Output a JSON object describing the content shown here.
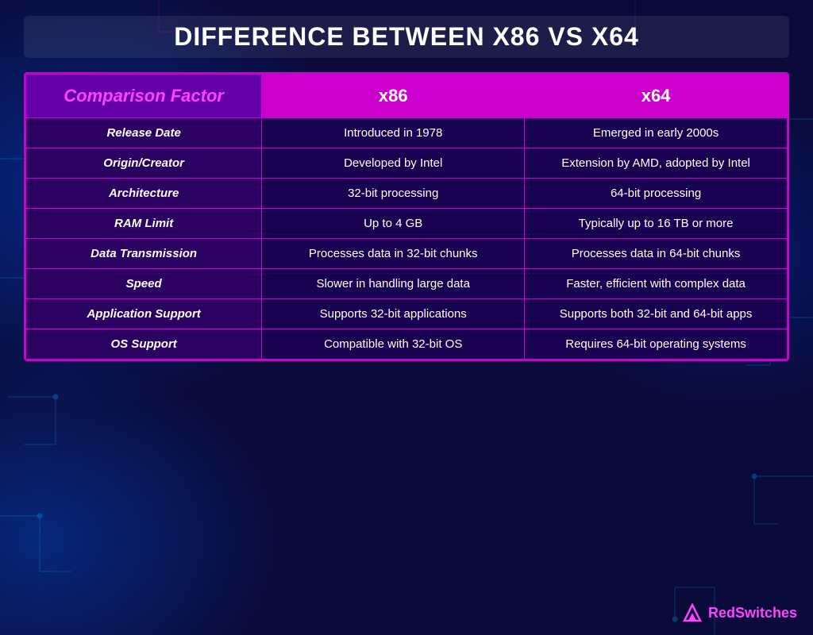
{
  "page": {
    "title": "DIFFERENCE BETWEEN X86 VS X64",
    "background_color": "#0a0a3a"
  },
  "table": {
    "headers": {
      "factor": "Comparison Factor",
      "x86": "x86",
      "x64": "x64"
    },
    "rows": [
      {
        "factor": "Release Date",
        "x86": "Introduced in 1978",
        "x64": "Emerged in early 2000s"
      },
      {
        "factor": "Origin/Creator",
        "x86": "Developed by Intel",
        "x64": "Extension by AMD, adopted by Intel"
      },
      {
        "factor": "Architecture",
        "x86": "32-bit processing",
        "x64": "64-bit processing"
      },
      {
        "factor": "RAM Limit",
        "x86": "Up to 4 GB",
        "x64": "Typically up to 16 TB or more"
      },
      {
        "factor": "Data Transmission",
        "x86": "Processes data in 32-bit chunks",
        "x64": "Processes data in 64-bit chunks"
      },
      {
        "factor": "Speed",
        "x86": "Slower in handling large data",
        "x64": "Faster, efficient with complex data"
      },
      {
        "factor": "Application Support",
        "x86": "Supports 32-bit applications",
        "x64": "Supports both 32-bit and 64-bit apps"
      },
      {
        "factor": "OS Support",
        "x86": "Compatible with 32-bit OS",
        "x64": "Requires 64-bit operating systems"
      }
    ]
  },
  "logo": {
    "name": "RedSwitches",
    "red_part": "Red",
    "switches_part": "Switches"
  }
}
